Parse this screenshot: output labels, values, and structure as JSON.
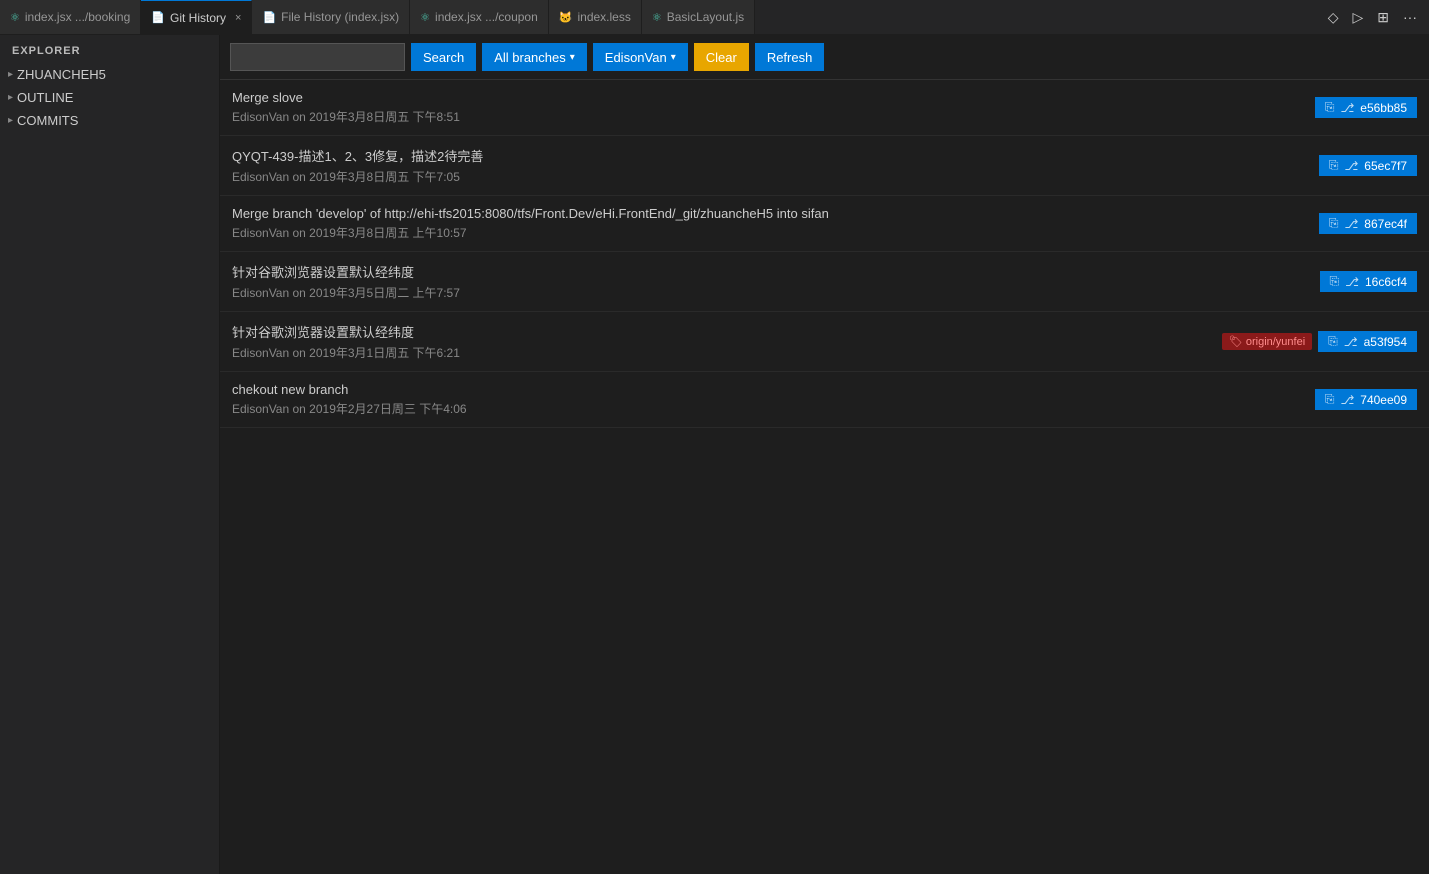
{
  "tabs": [
    {
      "id": "tab-indexjsx-booking",
      "icon": "⚛",
      "icon_color": "#4ec9b0",
      "label": "index.jsx",
      "sublabel": ".../booking",
      "active": false,
      "closeable": false
    },
    {
      "id": "tab-git-history",
      "icon": "📄",
      "icon_color": "#ccc",
      "label": "Git History",
      "sublabel": "",
      "active": true,
      "closeable": true
    },
    {
      "id": "tab-file-history",
      "icon": "📄",
      "icon_color": "#ccc",
      "label": "File History (index.jsx)",
      "sublabel": "",
      "active": false,
      "closeable": false
    },
    {
      "id": "tab-indexjsx-coupon",
      "icon": "⚛",
      "icon_color": "#4ec9b0",
      "label": "index.jsx",
      "sublabel": ".../coupon",
      "active": false,
      "closeable": false
    },
    {
      "id": "tab-indexless",
      "icon": "🐱",
      "icon_color": "#ccc",
      "label": "index.less",
      "sublabel": "",
      "active": false,
      "closeable": false
    },
    {
      "id": "tab-basiclayout",
      "icon": "⚛",
      "icon_color": "#4ec9b0",
      "label": "BasicLayout.js",
      "sublabel": "",
      "active": false,
      "closeable": false
    }
  ],
  "tab_actions": [
    "◇",
    "▷",
    "⊞",
    "···"
  ],
  "sidebar": {
    "title": "EXPLORER",
    "sections": [
      {
        "id": "zhuancheh5",
        "label": "ZHUANCHEH5",
        "expanded": false
      },
      {
        "id": "outline",
        "label": "OUTLINE",
        "expanded": false
      },
      {
        "id": "commits",
        "label": "COMMITS",
        "expanded": false
      }
    ]
  },
  "toolbar": {
    "search_placeholder": "",
    "search_label": "Search",
    "branches_label": "All branches",
    "user_label": "EdisonVan",
    "clear_label": "Clear",
    "refresh_label": "Refresh"
  },
  "commits": [
    {
      "id": "commit-1",
      "message": "Merge slove",
      "author": "EdisonVan",
      "date": "2019年3月8日周五 下午8:51",
      "hash": "e56bb85",
      "origin_badge": null
    },
    {
      "id": "commit-2",
      "message": "QYQT-439-描述1、2、3修复，描述2待完善",
      "author": "EdisonVan",
      "date": "2019年3月8日周五 下午7:05",
      "hash": "65ec7f7",
      "origin_badge": null
    },
    {
      "id": "commit-3",
      "message": "Merge branch 'develop' of http://ehi-tfs2015:8080/tfs/Front.Dev/eHi.FrontEnd/_git/zhuancheH5 into sifan",
      "author": "EdisonVan",
      "date": "2019年3月8日周五 上午10:57",
      "hash": "867ec4f",
      "origin_badge": null
    },
    {
      "id": "commit-4",
      "message": "针对谷歌浏览器设置默认经纬度",
      "author": "EdisonVan",
      "date": "2019年3月5日周二 上午7:57",
      "hash": "16c6cf4",
      "origin_badge": null
    },
    {
      "id": "commit-5",
      "message": "针对谷歌浏览器设置默认经纬度",
      "author": "EdisonVan",
      "date": "2019年3月1日周五 下午6:21",
      "hash": "a53f954",
      "origin_badge": "origin/yunfei"
    },
    {
      "id": "commit-6",
      "message": "chekout new branch",
      "author": "EdisonVan",
      "date": "2019年2月27日周三 下午4:06",
      "hash": "740ee09",
      "origin_badge": null
    }
  ]
}
